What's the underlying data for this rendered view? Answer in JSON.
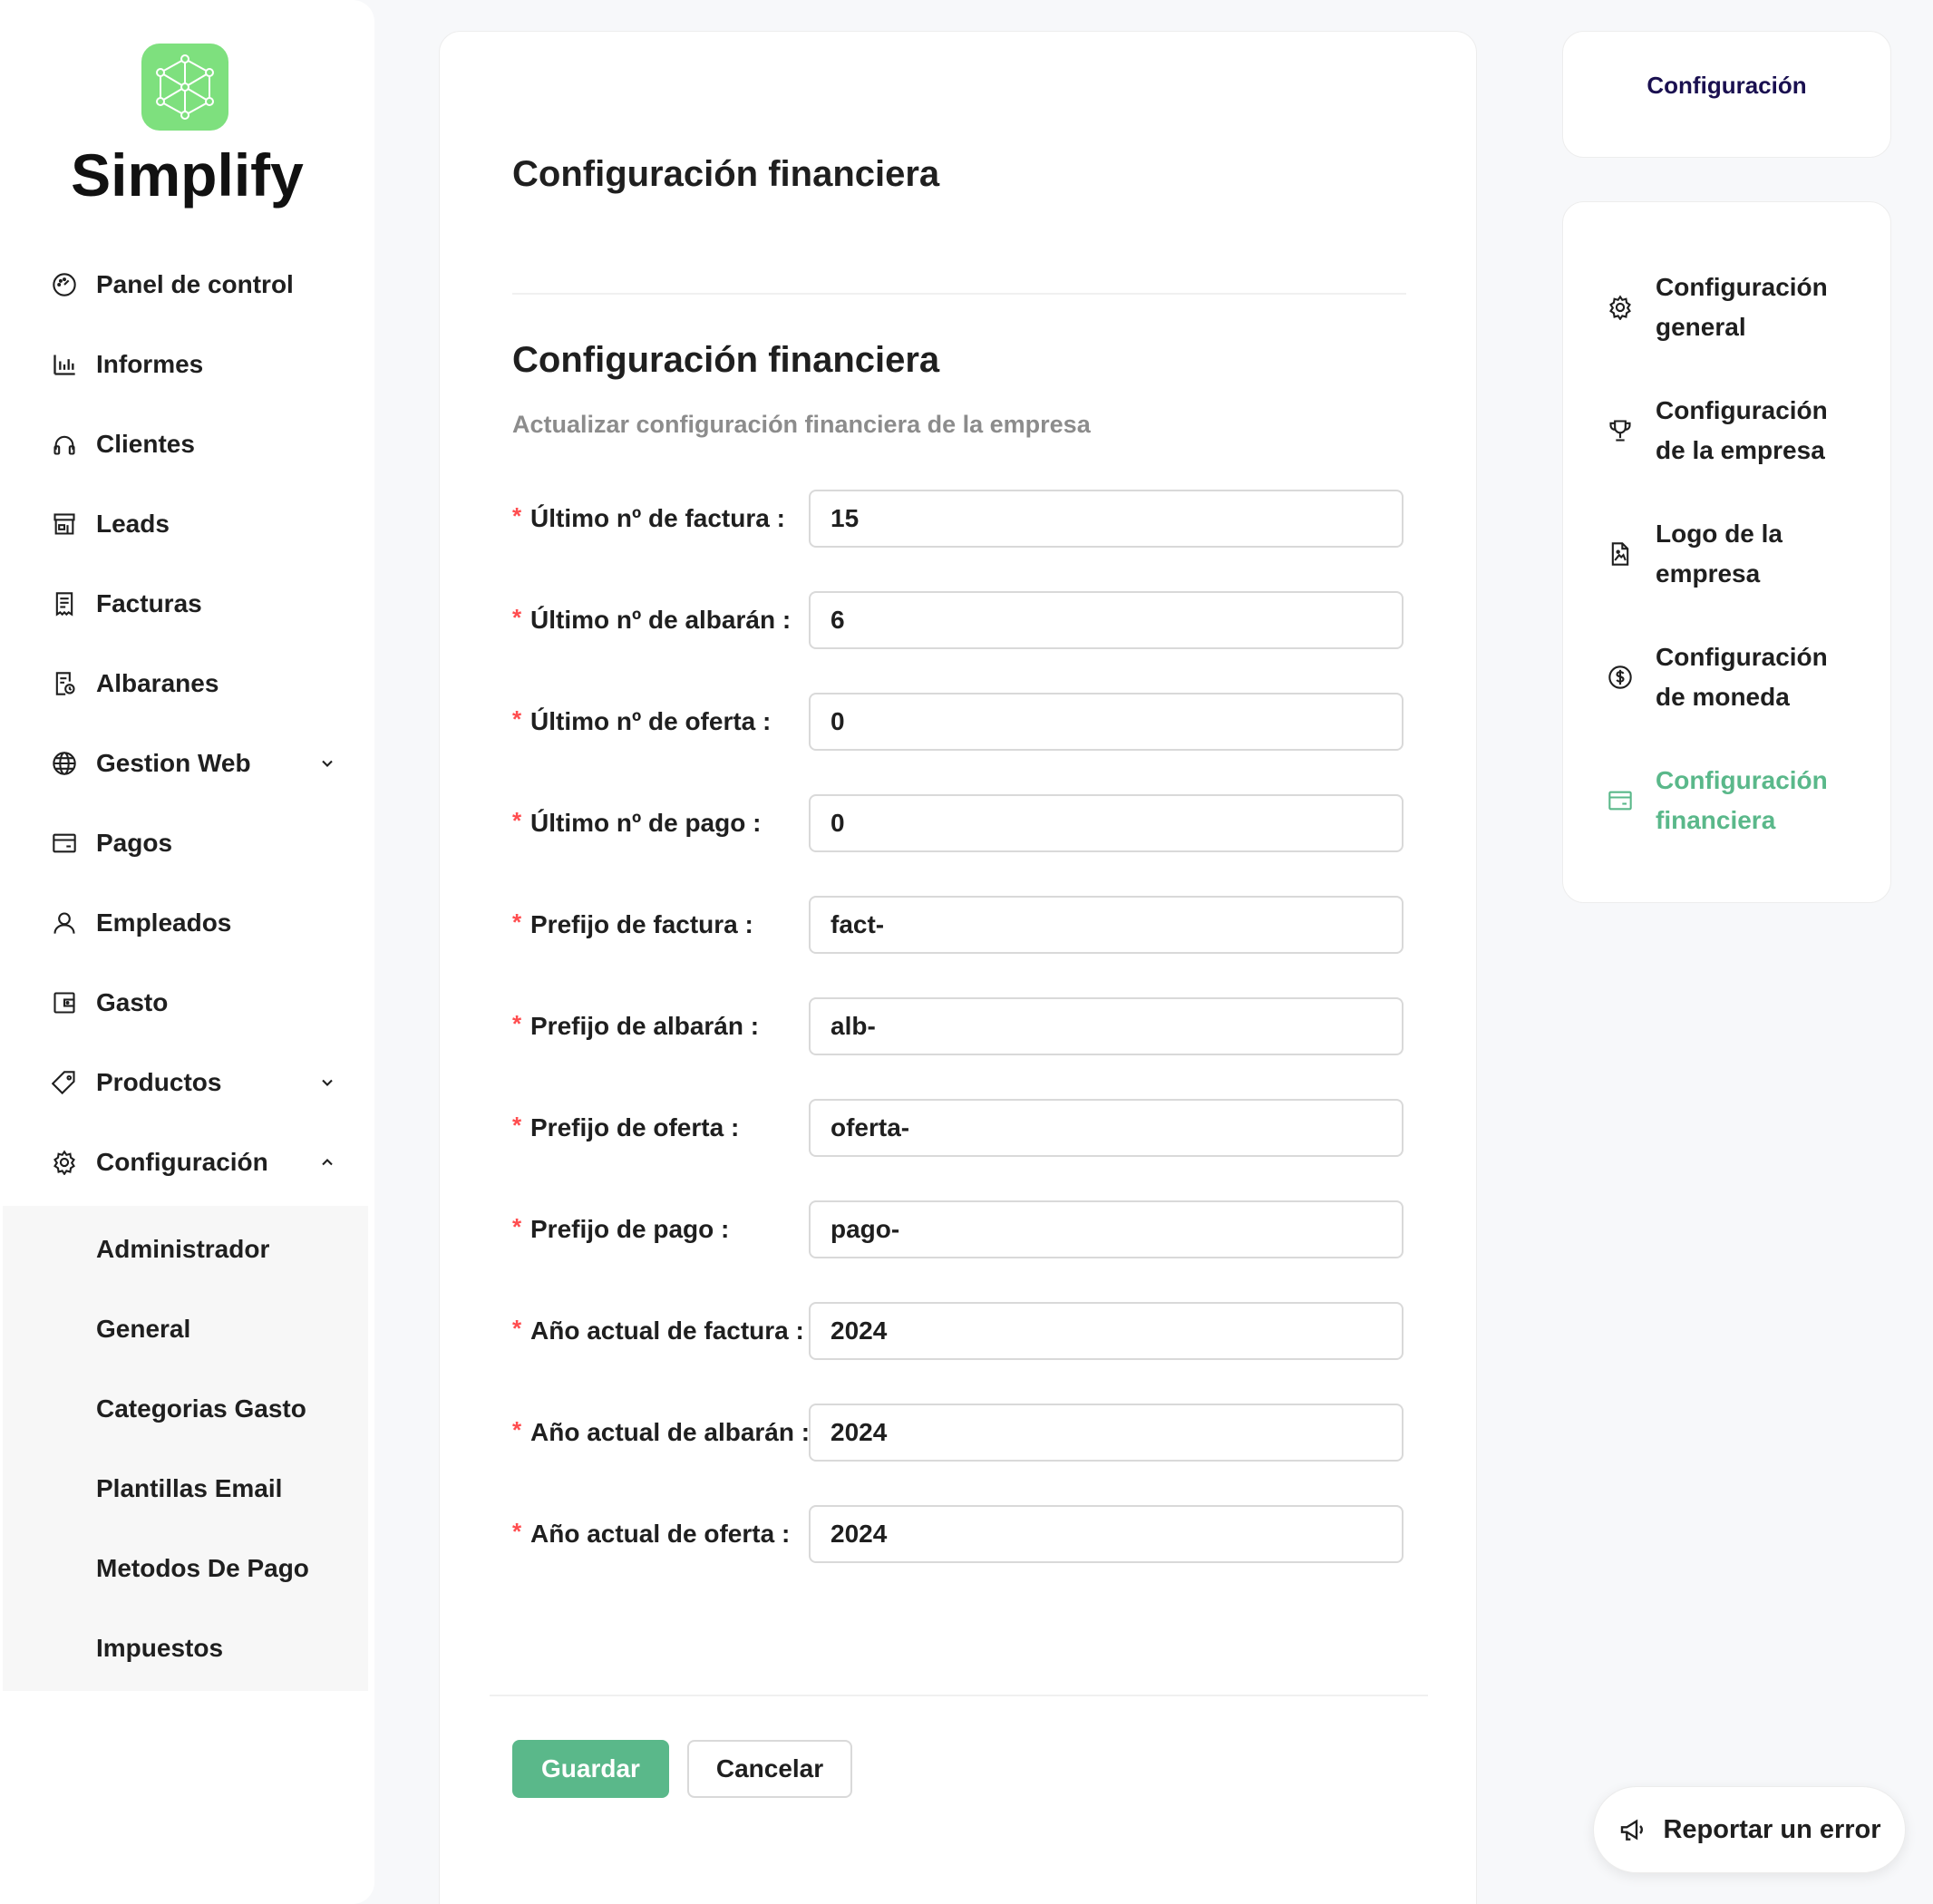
{
  "brand": {
    "name": "Simplify",
    "logo_icon": "network-cube-icon",
    "logo_color": "#7ee07e"
  },
  "sidebar": {
    "items": [
      {
        "label": "Panel de control",
        "icon": "dashboard-gauge-icon"
      },
      {
        "label": "Informes",
        "icon": "bar-chart-icon"
      },
      {
        "label": "Clientes",
        "icon": "headphones-icon"
      },
      {
        "label": "Leads",
        "icon": "storefront-icon"
      },
      {
        "label": "Facturas",
        "icon": "receipt-icon"
      },
      {
        "label": "Albaranes",
        "icon": "document-clock-icon"
      },
      {
        "label": "Gestion Web",
        "icon": "globe-icon",
        "expandable": true,
        "expanded": false
      },
      {
        "label": "Pagos",
        "icon": "credit-card-icon"
      },
      {
        "label": "Empleados",
        "icon": "user-icon"
      },
      {
        "label": "Gasto",
        "icon": "wallet-icon"
      },
      {
        "label": "Productos",
        "icon": "tag-icon",
        "expandable": true,
        "expanded": false
      },
      {
        "label": "Configuración",
        "icon": "gear-icon",
        "expandable": true,
        "expanded": true
      }
    ],
    "submenu": [
      "Administrador",
      "General",
      "Categorias Gasto",
      "Plantillas Email",
      "Metodos De Pago",
      "Impuestos"
    ]
  },
  "main": {
    "page_title": "Configuración financiera",
    "section_title": "Configuración financiera",
    "section_subtitle": "Actualizar configuración financiera de la empresa",
    "fields": [
      {
        "label": "Último nº de factura",
        "value": "15",
        "required": true
      },
      {
        "label": "Último nº de albarán",
        "value": "6",
        "required": true
      },
      {
        "label": "Último nº de oferta",
        "value": "0",
        "required": true
      },
      {
        "label": "Último nº de pago",
        "value": "0",
        "required": true
      },
      {
        "label": "Prefijo de factura",
        "value": "fact-",
        "required": true
      },
      {
        "label": "Prefijo de albarán",
        "value": "alb-",
        "required": true
      },
      {
        "label": "Prefijo de oferta",
        "value": "oferta-",
        "required": true
      },
      {
        "label": "Prefijo de pago",
        "value": "pago-",
        "required": true
      },
      {
        "label": "Año actual de factura",
        "value": "2024",
        "required": true
      },
      {
        "label": "Año actual de albarán",
        "value": "2024",
        "required": true
      },
      {
        "label": "Año actual de oferta",
        "value": "2024",
        "required": true
      }
    ],
    "required_mark": "*",
    "label_separator": ":",
    "save_label": "Guardar",
    "cancel_label": "Cancelar"
  },
  "right_panel": {
    "title": "Configuración",
    "items": [
      {
        "label": "Configuración general",
        "icon": "gear-icon",
        "active": false
      },
      {
        "label": "Configuración de la empresa",
        "icon": "trophy-icon",
        "active": false
      },
      {
        "label": "Logo de la empresa",
        "icon": "file-image-icon",
        "active": false
      },
      {
        "label": "Configuración de moneda",
        "icon": "dollar-circle-icon",
        "active": false
      },
      {
        "label": "Configuración financiera",
        "icon": "credit-card-icon",
        "active": true
      }
    ]
  },
  "report": {
    "label": "Reportar un error",
    "icon": "megaphone-icon"
  },
  "colors": {
    "accent": "#5ab88a",
    "required": "#ff4d4f",
    "title_navy": "#1a1050",
    "muted_text": "#8c8c8c"
  }
}
